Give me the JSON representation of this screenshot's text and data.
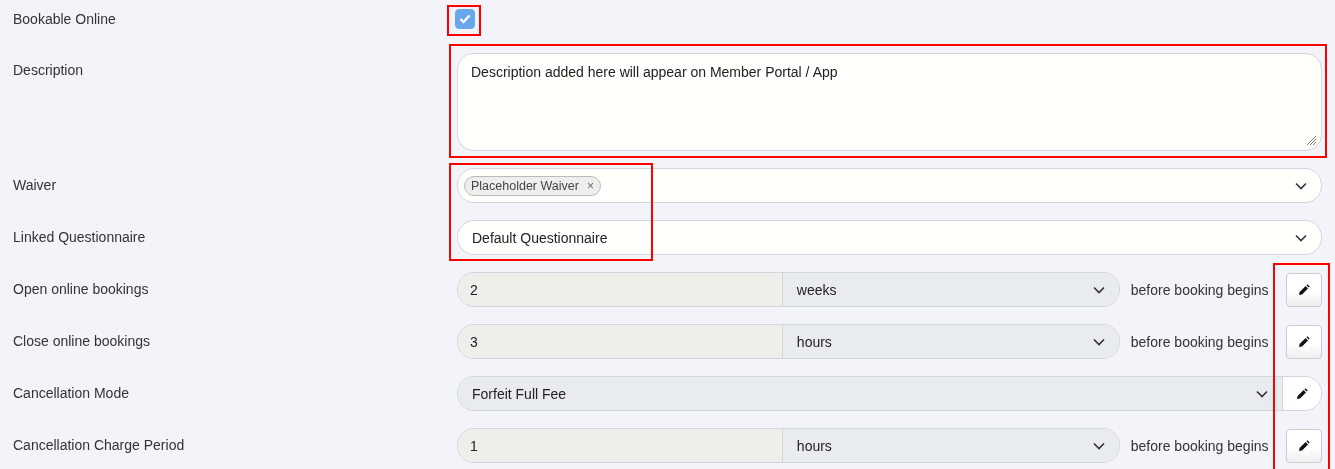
{
  "rows": [
    {
      "kind": "checkbox",
      "label": "Bookable Online",
      "checked": true,
      "highlighted": true
    },
    {
      "kind": "textarea",
      "label": "Description",
      "value": "Description added here will appear on Member Portal / App",
      "highlighted": true
    },
    {
      "kind": "tags",
      "label": "Waiver",
      "tags": [
        {
          "text": "Placeholder Waiver",
          "remove": "×"
        }
      ],
      "highlighted": true
    },
    {
      "kind": "select",
      "label": "Linked Questionnaire",
      "value": "Default Questionnaire",
      "highlighted": true
    },
    {
      "kind": "period",
      "label": "Open online bookings",
      "amount": "2",
      "unit": "weeks",
      "suffix": "before booking begins",
      "highlighted": true
    },
    {
      "kind": "period",
      "label": "Close online bookings",
      "amount": "3",
      "unit": "hours",
      "suffix": "before booking begins",
      "highlighted": true
    },
    {
      "kind": "mode",
      "label": "Cancellation Mode",
      "value": "Forfeit Full Fee",
      "highlighted": true
    },
    {
      "kind": "period",
      "label": "Cancellation Charge Period",
      "amount": "1",
      "unit": "hours",
      "suffix": "before booking begins",
      "highlighted": true
    }
  ]
}
